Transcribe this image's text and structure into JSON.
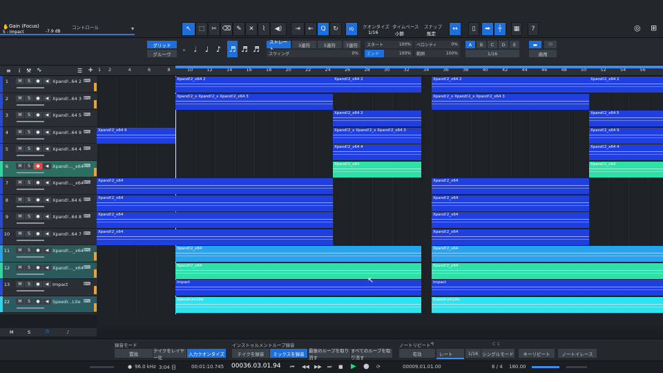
{
  "top": {
    "control_name": "Gain (Focus)",
    "control_target": "5 - Impact",
    "control_value": "-7.9 dB",
    "control_label": "コントロール",
    "quantize_label": "クオンタイズ",
    "quantize_value": "1/16",
    "timebase_label": "タイムベース",
    "timebase_value": "小節",
    "snap_label": "スナップ",
    "snap_value": "既定"
  },
  "quant": {
    "grid": "グリッド",
    "groove": "グルーヴ",
    "straight": "ストレート",
    "triplet3": "3連符",
    "quint5": "5連符",
    "sept7": "7連符",
    "swing_label": "スウィング",
    "swing_value": "0%",
    "start_label": "スタート",
    "start_value": "100%",
    "velocity_label": "ベロシティ",
    "velocity_value": "0%",
    "end_label": "エンド",
    "end_value": "100%",
    "range_label": "範囲",
    "range_value": "100%",
    "letters": [
      "A",
      "B",
      "C",
      "D",
      "E"
    ],
    "note_value": "1/16",
    "apply": "適用"
  },
  "ruler": [
    "1",
    "2",
    "4",
    "6",
    "8",
    "10",
    "12",
    "14",
    "16",
    "18",
    "20",
    "22",
    "24",
    "26",
    "28",
    "30",
    "32",
    "34",
    "36",
    "38",
    "40",
    "42",
    "44",
    "46",
    "48",
    "50",
    "52",
    "54",
    "56"
  ],
  "tracks": [
    {
      "num": "1",
      "name": "Xpand!..64 2",
      "color": "#2749d6"
    },
    {
      "num": "2",
      "name": "Xpand!..64 3",
      "color": "#2749d6"
    },
    {
      "num": "3",
      "name": "Xpand!..64 5",
      "color": "#2749d6"
    },
    {
      "num": "4",
      "name": "Xpand!..64 9",
      "color": "#2749d6"
    },
    {
      "num": "5",
      "name": "Xpand!..64 4",
      "color": "#2749d6"
    },
    {
      "num": "6",
      "name": "Xpand!..._x64",
      "color": "#2fd6a0"
    },
    {
      "num": "7",
      "name": "Xpand!..._x64",
      "color": "#2749d6"
    },
    {
      "num": "8",
      "name": "Xpand!..64 6",
      "color": "#2749d6"
    },
    {
      "num": "9",
      "name": "Xpand!..64 8",
      "color": "#2749d6"
    },
    {
      "num": "10",
      "name": "Xpand!..64 7",
      "color": "#2749d6"
    },
    {
      "num": "11",
      "name": "Xpand!..._x64",
      "color": "#27a3e6"
    },
    {
      "num": "12",
      "name": "Xpand!..._x64",
      "color": "#2fd6a0"
    },
    {
      "num": "13",
      "name": "Impact",
      "color": "#2749d6"
    },
    {
      "num": "22",
      "name": "Speedr...Lite",
      "color": "#29d8e6"
    }
  ],
  "clip_labels": {
    "t1": [
      "Xpand!2_x64 2",
      "Xpand!2_x64 2",
      "Xpand!2_x64 2",
      "Xpand!2_x64 2",
      "Xpand!2_x64 2"
    ],
    "t2": [
      "Xpand!2_x Xpand!2_x Xpand!2_x64 3",
      "Xpand!2_x Xpand!2_x Xpand!2_x64 3",
      "Xpand!2_x Xpand!2_x Xpand!2_x64 3"
    ],
    "impact": "Impact",
    "speed": "SpeedrumLite",
    "x64": "Xpand!2_x64",
    "x64_9": "Xpand!2_x64 9",
    "x64_5": "Xpand!2_x64 5",
    "x64_4": "Xpand!2_x64 4"
  },
  "bottom": {
    "rec_mode_label": "録音モード",
    "replace": "置換",
    "take_layer": "テイクをレイヤー化",
    "input_quant": "入力クオンタイズ",
    "loop_rec_label": "インストゥルメントループ録音",
    "take_rec": "テイクを録音",
    "mix_rec": "ミックスを録音",
    "last_loop": "最後のループを取り消す",
    "all_loops": "すべてのループを取り消す",
    "note_repeat_label": "ノートリピート",
    "enabled": "有効",
    "rate": "レート",
    "rate_value": "1/16",
    "single_mode": "シングルモード",
    "key_repeat": "キーリピート",
    "note_erase": "ノートイレース",
    "c1": "C 1"
  },
  "transport": {
    "sample_rate": "96.0 kHz",
    "rec_time": "3:04 日",
    "time": "00:01:10.745",
    "position": "00036.03.01.94",
    "loop_start": "00009.01.01.00",
    "signature": "6 / 4",
    "tempo": "180.00",
    "footer_m": "M",
    "footer_s": "S"
  },
  "colors": {
    "blue_clip": "#1f3fe0",
    "teal_clip": "#2fe0a8",
    "sky_clip": "#27a3f0",
    "cyan_clip": "#2de3f0",
    "accent": "#1e6fd9"
  }
}
